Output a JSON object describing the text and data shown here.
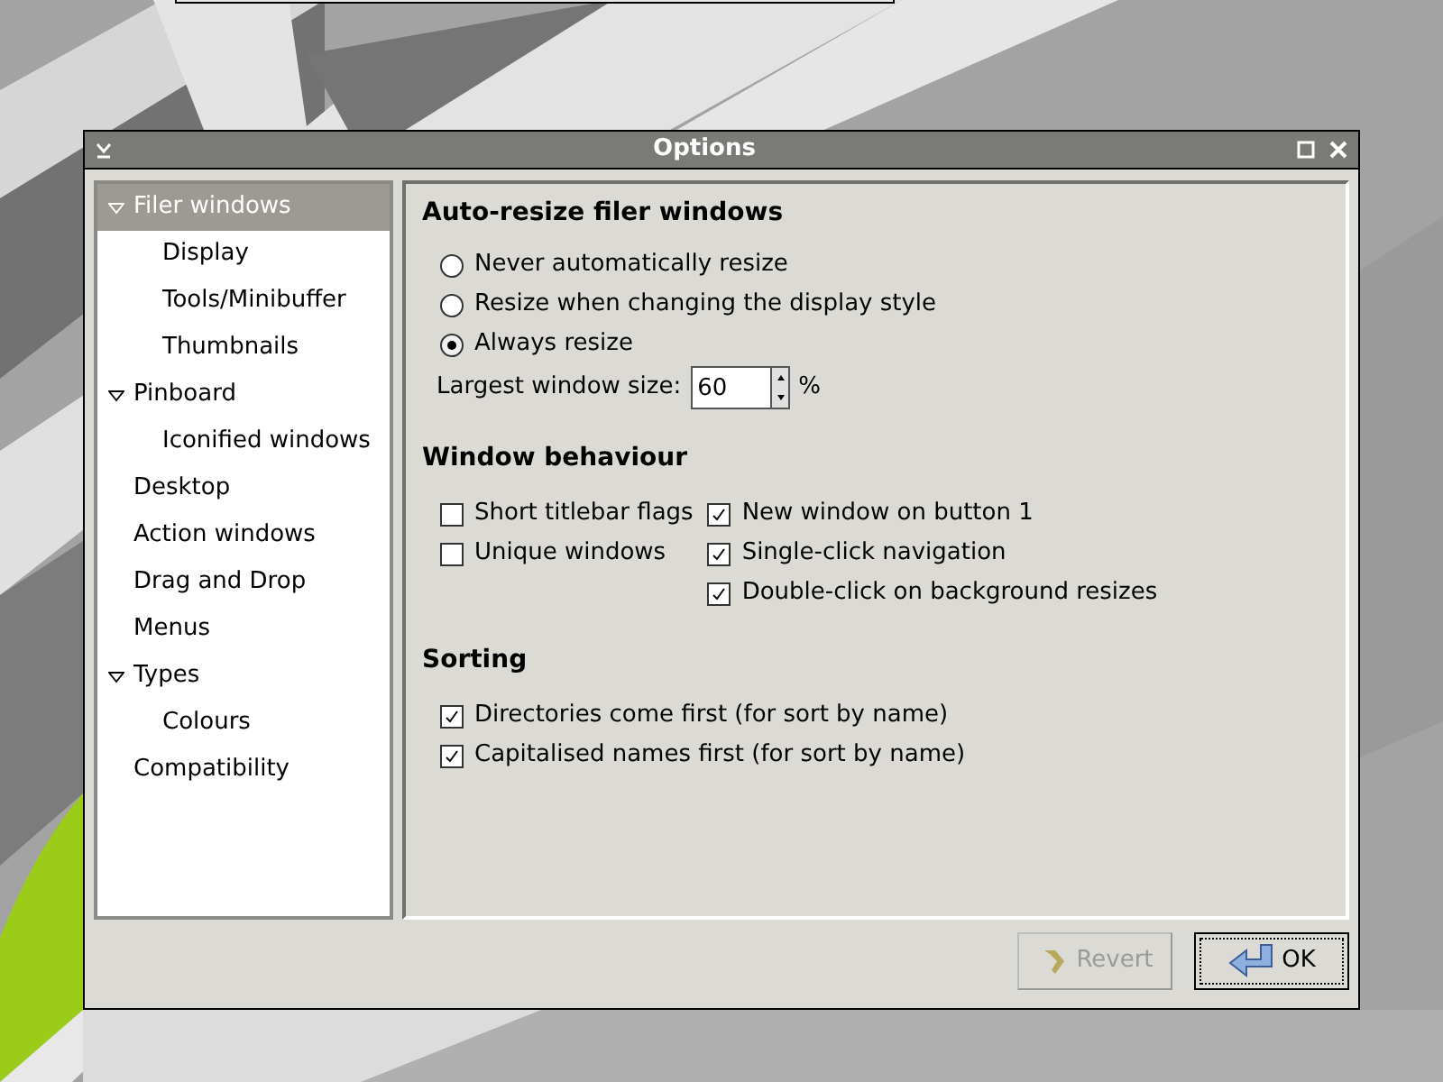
{
  "window": {
    "title": "Options"
  },
  "sidebar": {
    "items": [
      {
        "label": "Filer windows",
        "selected": true,
        "expanded": true,
        "children": [
          {
            "label": "Display",
            "selected": false
          },
          {
            "label": "Tools/Minibuffer",
            "selected": false
          },
          {
            "label": "Thumbnails",
            "selected": false
          }
        ]
      },
      {
        "label": "Pinboard",
        "selected": false,
        "expanded": true,
        "children": [
          {
            "label": "Iconified windows",
            "selected": false
          }
        ]
      },
      {
        "label": "Desktop",
        "selected": false
      },
      {
        "label": "Action windows",
        "selected": false
      },
      {
        "label": "Drag and Drop",
        "selected": false
      },
      {
        "label": "Menus",
        "selected": false
      },
      {
        "label": "Types",
        "selected": false,
        "expanded": true,
        "children": [
          {
            "label": "Colours",
            "selected": false
          }
        ]
      },
      {
        "label": "Compatibility",
        "selected": false
      }
    ]
  },
  "auto_resize": {
    "heading": "Auto-resize filer windows",
    "options": [
      {
        "label": "Never automatically resize",
        "selected": false
      },
      {
        "label": "Resize when changing the display style",
        "selected": false
      },
      {
        "label": "Always resize",
        "selected": true
      }
    ],
    "largest_size": {
      "label": "Largest window size:",
      "value": "60",
      "unit": "%"
    }
  },
  "window_behaviour": {
    "heading": "Window behaviour",
    "columns": [
      [
        {
          "label": "Short titlebar flags",
          "checked": false
        },
        {
          "label": "Unique windows",
          "checked": false
        }
      ],
      [
        {
          "label": "New window on button 1",
          "checked": true
        },
        {
          "label": "Single-click navigation",
          "checked": true
        },
        {
          "label": "Double-click on background resizes",
          "checked": true
        }
      ]
    ]
  },
  "sorting": {
    "heading": "Sorting",
    "options": [
      {
        "label": "Directories come first (for sort by name)",
        "checked": true
      },
      {
        "label": "Capitalised names first (for sort by name)",
        "checked": true
      }
    ]
  },
  "buttons": [
    {
      "label": "Revert",
      "kind": "revert",
      "disabled": true
    },
    {
      "label": "OK",
      "kind": "ok",
      "disabled": false
    }
  ]
}
